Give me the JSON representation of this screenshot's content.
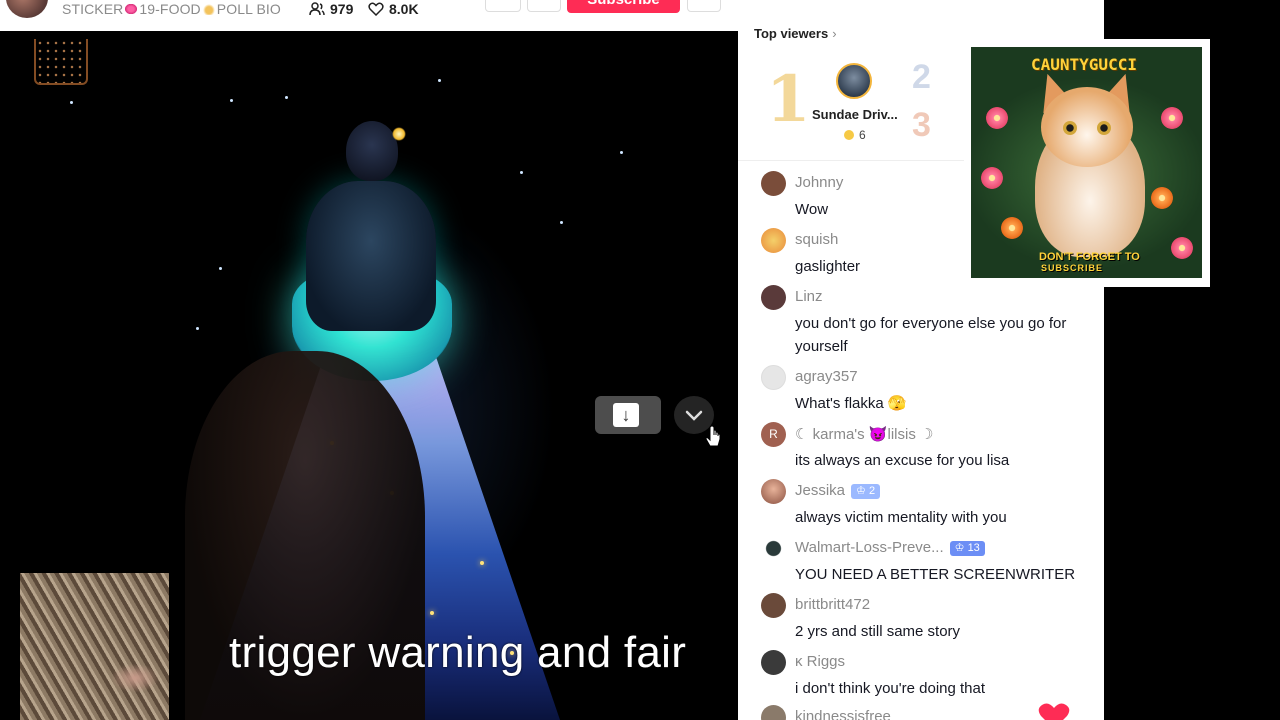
{
  "header": {
    "bio": [
      "STICKER",
      "19-FOOD",
      "POLL BIO"
    ],
    "viewers": "979",
    "likes": "8.0K",
    "subscribe_label": "Subscribe"
  },
  "video": {
    "subtitle": "trigger warning and fair",
    "download_icon": "download-icon",
    "chevron_icon": "chevron-down-icon"
  },
  "top_viewers": {
    "title": "Top viewers",
    "first": {
      "rank": "1",
      "name": "Sundae Driv...",
      "coins": "6"
    },
    "second_rank": "2",
    "third_rank": "3"
  },
  "chat": [
    {
      "user": "Johnny",
      "text": "Wow",
      "avatar": "#7a4d3a"
    },
    {
      "user": "squish",
      "text": "gaslighter",
      "avatar": "#e9a84a"
    },
    {
      "user": "Linz",
      "text": "you don't go for everyone else you go for yourself",
      "avatar": "#5a3a3a"
    },
    {
      "user": "agray357",
      "text": "What's flakka",
      "avatar": "#e3e3e3",
      "emoji": "🫣"
    },
    {
      "user": "karma's 😈lilsis",
      "text": "its always an excuse for you lisa",
      "avatar": "#a06050",
      "initial": "R"
    },
    {
      "user": "Jessika",
      "text": "always victim mentality with you",
      "avatar": "#c98a70",
      "badge": "2"
    },
    {
      "user": "Walmart-Loss-Preve...",
      "text": "YOU NEED A BETTER SCREENWRITER",
      "avatar": "#2a3a3a",
      "badge": "13"
    },
    {
      "user": "brittbritt472",
      "text": "2 yrs and still same story",
      "avatar": "#6a4a3a"
    },
    {
      "user": "ĸ Riggs",
      "text": "i don't think you're doing that",
      "avatar": "#3a3a3a"
    },
    {
      "user": "kindnessisfree",
      "text": "",
      "avatar": "#8a7a6a"
    }
  ],
  "ad": {
    "brand": "CAUNTYGUCCI",
    "cta_line1": "DON'T FORGET TO",
    "cta_line2": "SUBSCRIBE"
  },
  "colors": {
    "accent": "#fe2c55",
    "muted_text": "#8a8a8a"
  }
}
